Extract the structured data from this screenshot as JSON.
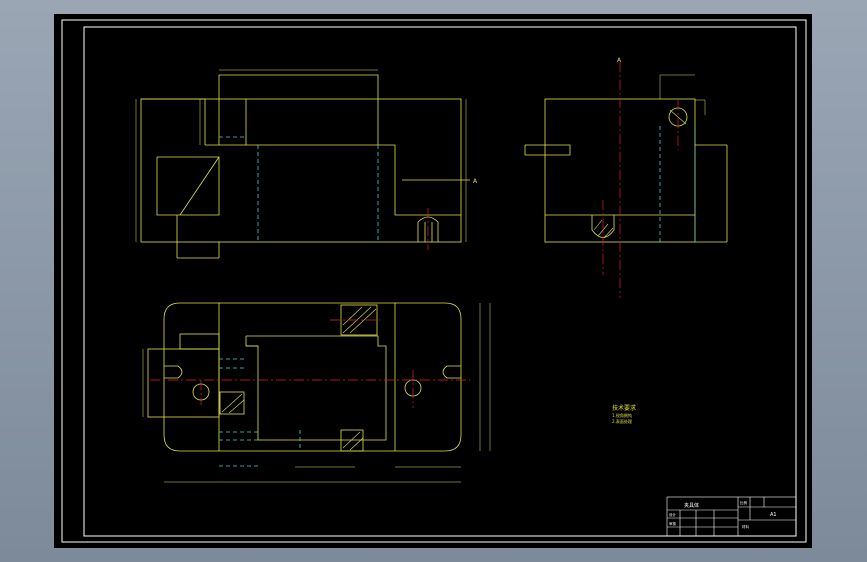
{
  "colors": {
    "background": "#000000",
    "outline": "#e0e04a",
    "center_line": "#e02020",
    "hidden_line": "#3ad6d6",
    "dimension": "#e0e04a",
    "hatch": "#e0e04a",
    "frame": "#ffffff"
  },
  "drawing": {
    "section_marker_top": "A",
    "section_marker_front": "A",
    "notes": {
      "title": "技术要求",
      "line1": "1.锐角倒钝",
      "line2": "2.表面处理"
    },
    "title_block": {
      "part_name": "夹具体",
      "scale_label": "比例",
      "sheet_label": "A1",
      "designer_label": "设计",
      "checker_label": "审核",
      "material_label": "材料"
    }
  }
}
